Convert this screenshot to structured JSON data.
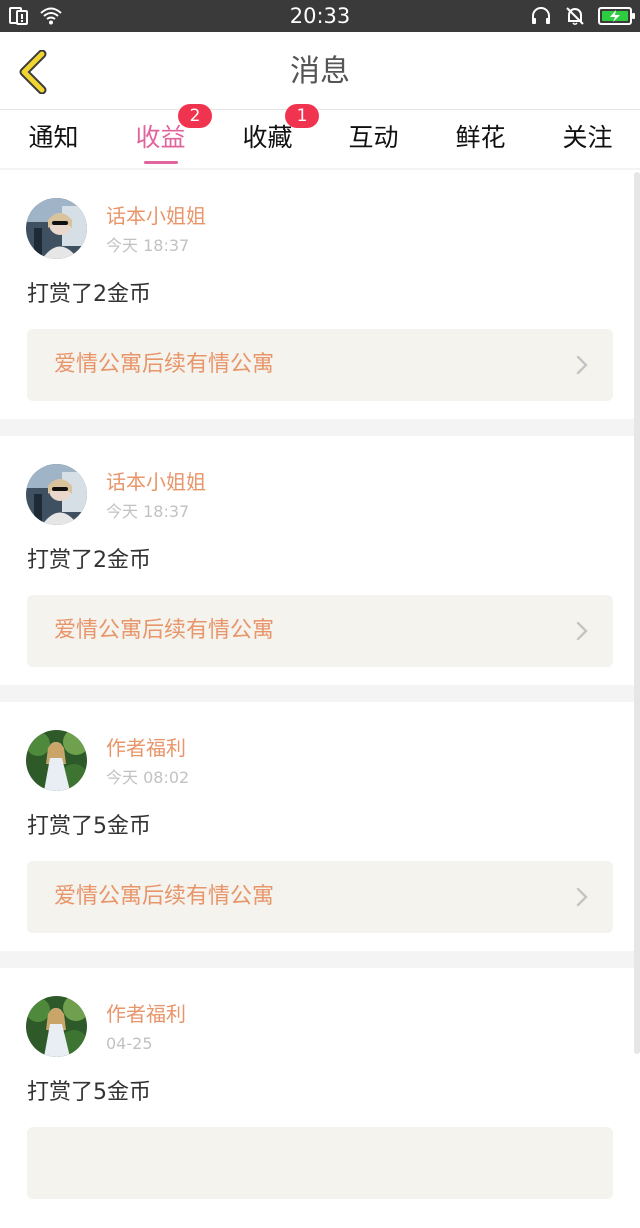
{
  "status_bar": {
    "time": "20:33",
    "icons_left": [
      "sim-alert-icon",
      "wifi-icon"
    ],
    "icons_right": [
      "headset-icon",
      "mute-bell-icon",
      "battery-charging-icon"
    ]
  },
  "header": {
    "title": "消息",
    "back_icon": "chevron-left-icon",
    "back_color": "#f1d531"
  },
  "tabs": [
    {
      "label": "通知",
      "active": false,
      "badge": ""
    },
    {
      "label": "收益",
      "active": true,
      "badge": "2"
    },
    {
      "label": "收藏",
      "active": false,
      "badge": "1"
    },
    {
      "label": "互动",
      "active": false,
      "badge": ""
    },
    {
      "label": "鲜花",
      "active": false,
      "badge": ""
    },
    {
      "label": "关注",
      "active": false,
      "badge": ""
    }
  ],
  "messages": [
    {
      "user": "话本小姐姐",
      "time": "今天 18:37",
      "text": "打赏了2金币",
      "book": "爱情公寓后续有情公寓",
      "avatar": "woman-in-car-photo"
    },
    {
      "user": "话本小姐姐",
      "time": "今天 18:37",
      "text": "打赏了2金币",
      "book": "爱情公寓后续有情公寓",
      "avatar": "woman-in-car-photo"
    },
    {
      "user": "作者福利",
      "time": "今天 08:02",
      "text": "打赏了5金币",
      "book": "爱情公寓后续有情公寓",
      "avatar": "girl-in-forest-photo"
    },
    {
      "user": "作者福利",
      "time": "04-25",
      "text": "打赏了5金币",
      "book": "",
      "avatar": "girl-in-forest-photo"
    }
  ],
  "colors": {
    "accent_pink": "#e2649c",
    "badge_red": "#f0334f",
    "name_orange": "#e8956a",
    "card_link_bg": "#f4f3ee"
  }
}
